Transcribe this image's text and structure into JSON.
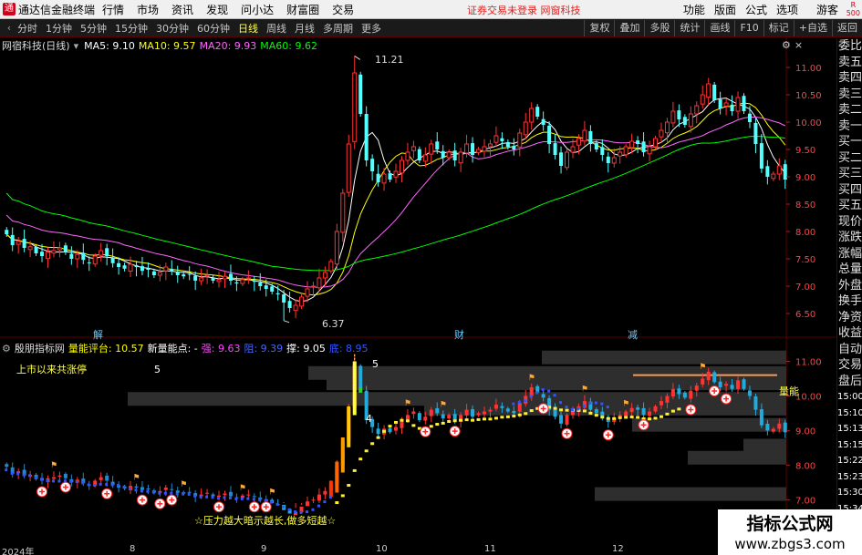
{
  "menubar": {
    "app_title": "通达信金融终端",
    "items": [
      "行情",
      "市场",
      "资讯",
      "发现",
      "问小达",
      "财富圈",
      "交易"
    ],
    "notice": "证券交易未登录  网窗科技",
    "right_items": [
      "功能",
      "版面",
      "公式",
      "选项"
    ],
    "guest": "游客",
    "badge_top": "R",
    "badge_bottom": "500"
  },
  "toolbar": {
    "periods": [
      "分时",
      "1分钟",
      "5分钟",
      "15分钟",
      "30分钟",
      "60分钟",
      "日线",
      "周线",
      "月线",
      "多周期",
      "更多"
    ],
    "active_period": "日线",
    "right_buttons": [
      "复权",
      "叠加",
      "多股",
      "统计",
      "画线",
      "F10",
      "标记",
      "+自选",
      "返回"
    ]
  },
  "main_info": {
    "stock_name": "网宿科技(日线)",
    "ma5": "MA5: 9.10",
    "ma10": "MA10: 9.57",
    "ma20": "MA20: 9.93",
    "ma60": "MA60: 9.62"
  },
  "main_labels": {
    "high_label": "11.21",
    "low_label": "6.37",
    "marker_jie": "解",
    "marker_cai": "财",
    "marker_jian": "减"
  },
  "indicator_info": {
    "name": "殷朋指标网",
    "energy": "量能评台: 10.57",
    "new_energy": "新量能点: -",
    "press": "强: 9.63",
    "mid": "阻: 9.39",
    "support": "撑: 9.05",
    "low": "底: 8.95",
    "limit_up_label": "上市以来共涨停",
    "limit_up_count": "5",
    "energy_tag": "量能",
    "bar_label_top": "5",
    "bar_label_mid": "4",
    "slogan": "☆压力越大暗示越长,做多短越☆"
  },
  "price_axis_main": [
    "11.00",
    "10.50",
    "10.00",
    "9.50",
    "9.00",
    "8.50",
    "8.00",
    "7.50",
    "7.00",
    "6.50"
  ],
  "price_axis_sub": [
    "11.00",
    "10.00",
    "9.00",
    "8.00",
    "7.00"
  ],
  "timeline": [
    "2024年",
    "8",
    "9",
    "10",
    "11",
    "12"
  ],
  "side_panel": [
    "委比",
    "卖五",
    "卖四",
    "卖三",
    "卖二",
    "卖一",
    "买一",
    "买二",
    "买三",
    "买四",
    "买五",
    "现价",
    "涨跌",
    "涨幅",
    "总量",
    "外盘",
    "换手",
    "净资",
    "收益",
    "自动",
    "交易",
    "盘后",
    "15:00",
    "15:10",
    "15:13",
    "15:15",
    "15:22",
    "15:23",
    "15:30",
    "15:34"
  ],
  "watermark": {
    "line1": "指标公式网",
    "line2": "www.zbgs3.com"
  },
  "colors": {
    "up": "#ff3333",
    "down": "#54ffff",
    "ma5": "#ffffff",
    "ma10": "#ffff00",
    "ma20": "#ff66ff",
    "ma60": "#00ff00",
    "panel_border": "#5a0000"
  },
  "chart_data": {
    "type": "candlestick",
    "price_range": [
      6.2,
      11.3
    ],
    "closes": [
      7.95,
      7.75,
      7.82,
      7.7,
      7.72,
      7.6,
      7.55,
      7.62,
      7.65,
      7.7,
      7.62,
      7.5,
      7.58,
      7.48,
      7.42,
      7.55,
      7.65,
      7.55,
      7.42,
      7.35,
      7.32,
      7.4,
      7.35,
      7.28,
      7.3,
      7.2,
      7.25,
      7.35,
      7.28,
      7.2,
      7.18,
      7.22,
      7.1,
      7.15,
      7.2,
      7.1,
      7.12,
      7.18,
      7.1,
      7.05,
      7.12,
      7.15,
      7.08,
      7.0,
      6.95,
      6.9,
      6.85,
      6.7,
      6.6,
      6.65,
      6.8,
      6.95,
      7.0,
      7.15,
      7.25,
      7.45,
      8.0,
      8.7,
      9.6,
      10.9,
      10.15,
      9.3,
      9.1,
      8.9,
      9.05,
      8.95,
      9.1,
      9.3,
      9.45,
      9.55,
      9.3,
      9.4,
      9.6,
      9.5,
      9.35,
      9.45,
      9.3,
      9.45,
      9.6,
      9.4,
      9.5,
      9.55,
      9.6,
      9.75,
      9.65,
      9.55,
      9.5,
      9.8,
      10.0,
      10.25,
      10.1,
      9.95,
      9.6,
      9.4,
      9.2,
      9.45,
      9.55,
      9.7,
      9.85,
      9.6,
      9.5,
      9.4,
      9.25,
      9.35,
      9.45,
      9.55,
      9.65,
      9.6,
      9.45,
      9.55,
      9.7,
      9.85,
      10.0,
      10.2,
      10.05,
      9.95,
      10.15,
      10.3,
      10.5,
      10.7,
      10.4,
      10.25,
      10.35,
      10.2,
      10.45,
      10.2,
      10.0,
      9.6,
      9.15,
      9.0,
      9.05,
      9.2,
      8.95
    ],
    "yellow_start_index": 56,
    "green_bar_index": 59
  }
}
